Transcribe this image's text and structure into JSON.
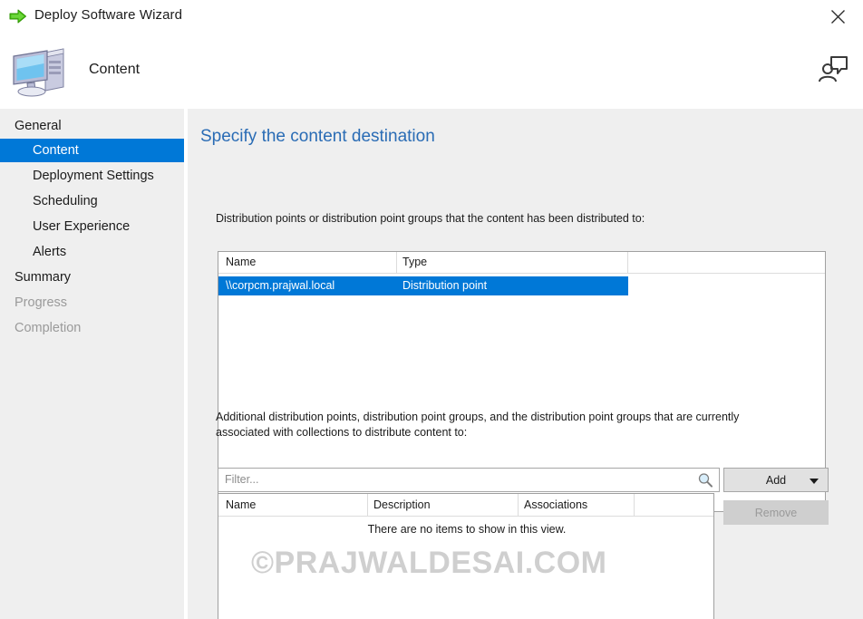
{
  "window": {
    "title": "Deploy Software Wizard",
    "arrow_icon": "green-right-arrow-icon",
    "close_icon": "close-icon"
  },
  "header": {
    "title": "Content",
    "computer_icon": "computer-icon",
    "feedback_icon": "user-feedback-icon"
  },
  "sidebar": {
    "items": [
      {
        "label": "General",
        "level": 0,
        "state": "normal"
      },
      {
        "label": "Content",
        "level": 1,
        "state": "selected"
      },
      {
        "label": "Deployment Settings",
        "level": 1,
        "state": "normal"
      },
      {
        "label": "Scheduling",
        "level": 1,
        "state": "normal"
      },
      {
        "label": "User Experience",
        "level": 1,
        "state": "normal"
      },
      {
        "label": "Alerts",
        "level": 1,
        "state": "normal"
      },
      {
        "label": "Summary",
        "level": 0,
        "state": "normal"
      },
      {
        "label": "Progress",
        "level": 0,
        "state": "disabled"
      },
      {
        "label": "Completion",
        "level": 0,
        "state": "disabled"
      }
    ]
  },
  "main": {
    "heading": "Specify the content destination",
    "distributed_label": "Distribution points or distribution point groups that the content has been distributed to:",
    "additional_label": "Additional distribution points, distribution point groups, and the distribution point groups that are currently associated with collections to distribute content to:",
    "distributed_table": {
      "columns": [
        "Name",
        "Type"
      ],
      "rows": [
        {
          "name": "\\\\corpcm.prajwal.local",
          "type": "Distribution point",
          "selected": true
        }
      ]
    },
    "filter": {
      "placeholder": "Filter...",
      "value": "",
      "search_icon": "search-icon"
    },
    "buttons": {
      "add": "Add",
      "remove": "Remove",
      "add_has_dropdown": true,
      "remove_enabled": false
    },
    "additional_table": {
      "columns": [
        "Name",
        "Description",
        "Associations"
      ],
      "empty_message": "There are no items to show in this view."
    }
  },
  "watermark": {
    "text": "©PRAJWALDESAI.COM"
  },
  "colors": {
    "accent": "#0078d7",
    "heading": "#2a6cb5",
    "body_bg": "#efefef",
    "disabled_text": "#9a9a9a"
  }
}
